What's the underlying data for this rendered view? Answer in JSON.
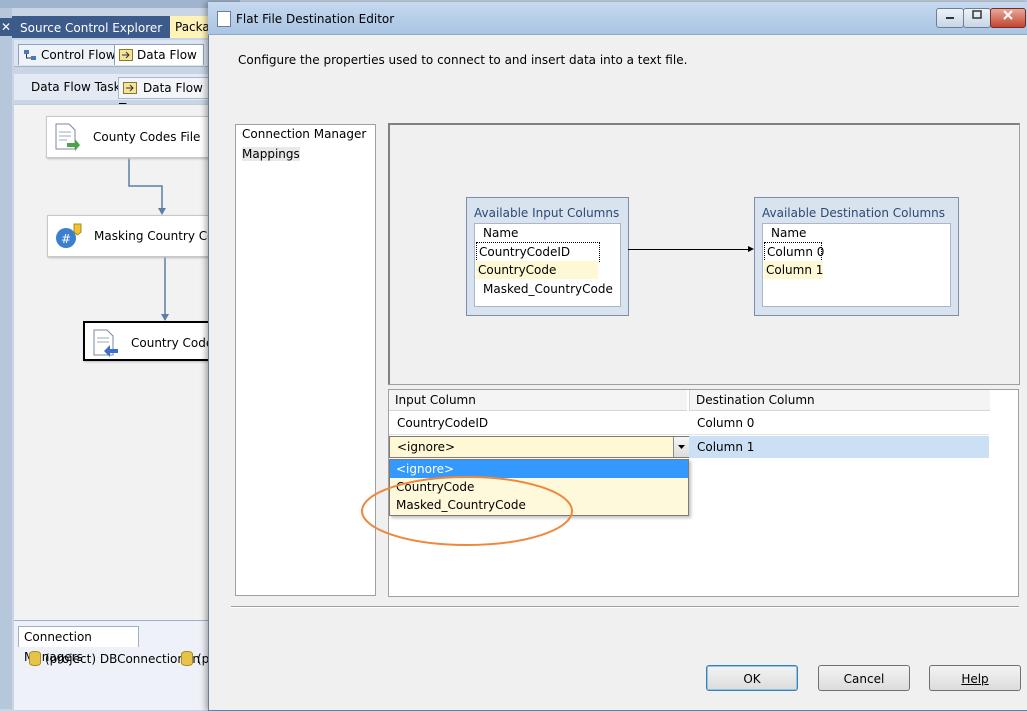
{
  "ide": {
    "tabs": {
      "source_control": "Source Control Explorer",
      "package": "Packa"
    },
    "designer_tabs": {
      "control_flow": "Control Flow",
      "data_flow": "Data Flow"
    },
    "data_flow_task_label": "Data Flow Task:",
    "data_flow_task_value": "Data Flow Ta",
    "nodes": [
      "County Codes File",
      "Masking Country Code D",
      "Country Codes C"
    ],
    "connection_managers": {
      "tab": "Connection Managers",
      "items": [
        "(project) DBConnection In",
        "(p"
      ]
    }
  },
  "dialog": {
    "title": "Flat File Destination Editor",
    "instruction": "Configure the properties used to connect to and insert data into a text file.",
    "nav": [
      "Connection Manager",
      "Mappings"
    ],
    "input_columns": {
      "caption": "Available Input Columns",
      "header": "Name",
      "rows": [
        "CountryCodeID",
        "CountryCode",
        "Masked_CountryCode"
      ]
    },
    "destination_columns": {
      "caption": "Available Destination Columns",
      "header": "Name",
      "rows": [
        "Column 0",
        "Column 1"
      ]
    },
    "grid": {
      "headers": [
        "Input Column",
        "Destination Column"
      ],
      "rows": [
        {
          "input": "CountryCodeID",
          "destination": "Column 0"
        },
        {
          "input": "<ignore>",
          "destination": "Column 1"
        }
      ]
    },
    "dropdown_options": [
      "<ignore>",
      "CountryCode",
      "Masked_CountryCode"
    ],
    "buttons": {
      "ok": "OK",
      "cancel": "Cancel",
      "help": "Help"
    }
  },
  "colors": {
    "annotation": "#f0883c",
    "selection": "#3399ff",
    "highlight_row": "#cce0f5"
  }
}
